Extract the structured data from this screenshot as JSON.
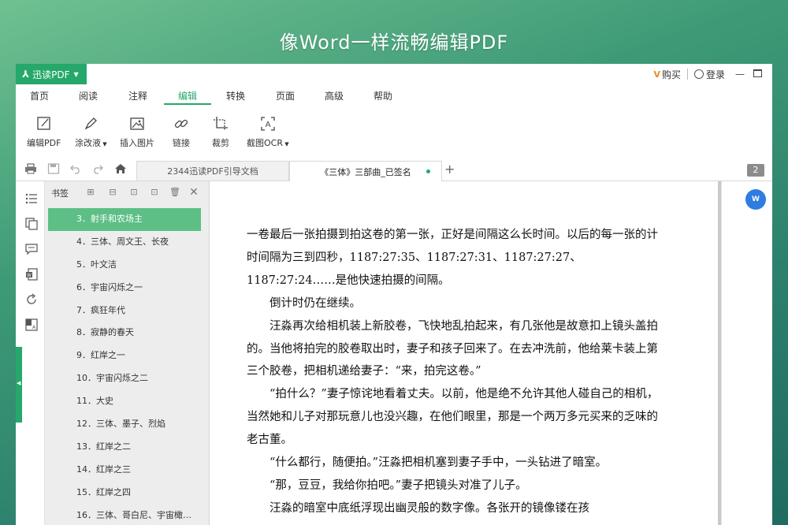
{
  "banner": {
    "title": "像Word一样流畅编辑PDF"
  },
  "app": {
    "name": "迅读PDF",
    "buy_label": "购买",
    "login_label": "登录",
    "vip_label": "V"
  },
  "menu": {
    "tabs": [
      {
        "label": "首页"
      },
      {
        "label": "阅读"
      },
      {
        "label": "注释"
      },
      {
        "label": "编辑"
      },
      {
        "label": "转换"
      },
      {
        "label": "页面"
      },
      {
        "label": "高级"
      },
      {
        "label": "帮助"
      }
    ],
    "active_index": 3
  },
  "toolbar": {
    "edit_pdf": "编辑PDF",
    "correction": "涂改液",
    "insert_image": "插入图片",
    "link": "链接",
    "crop": "裁剪",
    "screenshot_ocr": "截图OCR"
  },
  "tabs": [
    {
      "label": "2344迅读PDF引导文档"
    },
    {
      "label": "《三体》三部曲_已签名"
    }
  ],
  "page_count_badge": "2",
  "bookmark_panel": {
    "title": "书签",
    "items": [
      {
        "label": "3．射手和农场主"
      },
      {
        "label": "4．三体、周文王、长夜"
      },
      {
        "label": "5．叶文洁"
      },
      {
        "label": "6．宇宙闪烁之一"
      },
      {
        "label": "7．疯狂年代"
      },
      {
        "label": "8．寂静的春天"
      },
      {
        "label": "9．红岸之一"
      },
      {
        "label": "10．宇宙闪烁之二"
      },
      {
        "label": "11．大史"
      },
      {
        "label": "12．三体、墨子、烈焰"
      },
      {
        "label": "13．红岸之二"
      },
      {
        "label": "14．红岸之三"
      },
      {
        "label": "15．红岸之四"
      },
      {
        "label": "16．三体、哥白尼、宇宙橄…"
      }
    ]
  },
  "document": {
    "paragraphs": [
      "一卷最后一张拍摄到拍这卷的第一张，正好是间隔这么长时间。以后的每一张的计时间隔为三到四秒，1187:27:35、1187:27:31、1187:27:27、1187:27:24……是他快速拍摄的间隔。",
      "倒计时仍在继续。",
      "汪淼再次给相机装上新胶卷，飞快地乱拍起来，有几张他是故意扣上镜头盖拍的。当他将拍完的胶卷取出时，妻子和孩子回来了。在去冲洗前，他给莱卡装上第三个胶卷，把相机递给妻子：“来，拍完这卷。”",
      "“拍什么？”妻子惊诧地看着丈夫。以前，他是绝不允许其他人碰自己的相机，当然她和儿子对那玩意儿也没兴趣，在他们眼里，那是一个两万多元买来的乏味的老古董。",
      "“什么都行，随便拍。”汪淼把相机塞到妻子手中，一头钻进了暗室。",
      "“那，豆豆，我给你拍吧。”妻子把镜头对准了儿子。",
      "汪淼的暗室中底纸浮现出幽灵般的数字像。各张开的镜像镂在孩"
    ]
  }
}
